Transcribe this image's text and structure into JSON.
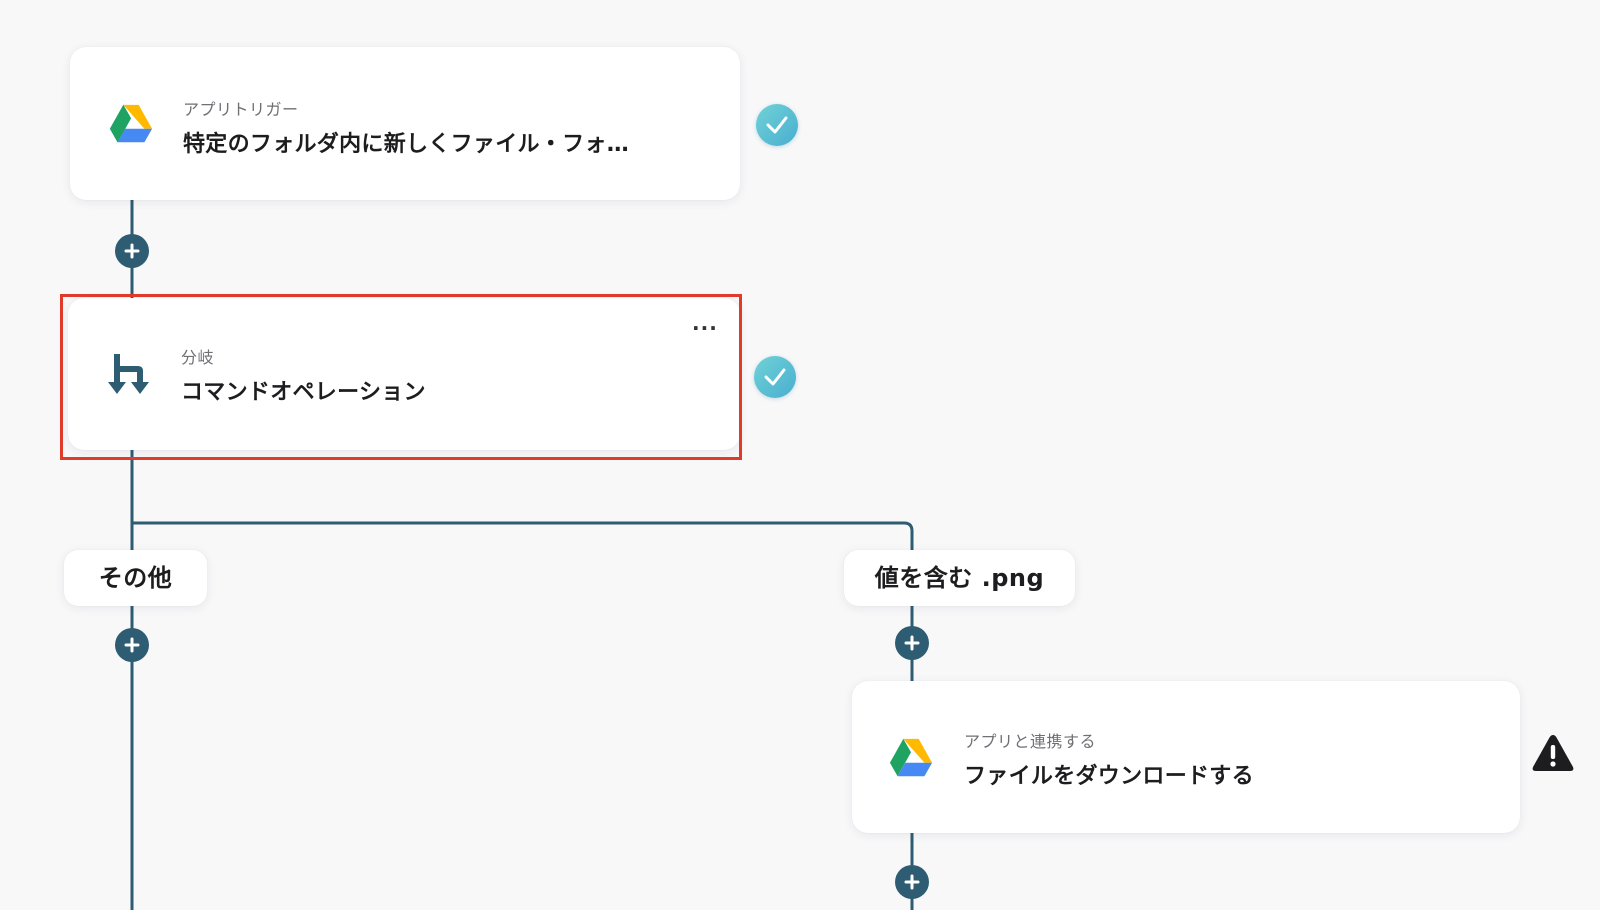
{
  "trigger_card": {
    "subtitle": "アプリトリガー",
    "title": "特定のフォルダ内に新しくファイル・フォ…",
    "app_icon": "google-drive-icon",
    "status": "completed",
    "status_icon": "check-icon"
  },
  "branch_card": {
    "subtitle": "分岐",
    "title": "コマンドオペレーション",
    "app_icon": "branch-icon",
    "more_label": "···",
    "status": "completed",
    "status_icon": "check-icon",
    "highlighted": true
  },
  "branches": [
    {
      "label": "その他"
    },
    {
      "label": "値を含む .png"
    }
  ],
  "download_card": {
    "subtitle": "アプリと連携する",
    "title": "ファイルをダウンロードする",
    "app_icon": "google-drive-icon",
    "status": "warning",
    "status_icon": "warning-icon"
  },
  "add_node_icon": "plus-icon",
  "colors": {
    "connector": "#2e5d73",
    "background": "#f8f8f9",
    "check_badge": "#55bfd3",
    "highlight": "#e03a2a",
    "drive_green": "#1ea362",
    "drive_yellow": "#ffba00",
    "drive_blue": "#4688f4",
    "drive_red": "#e94235"
  }
}
